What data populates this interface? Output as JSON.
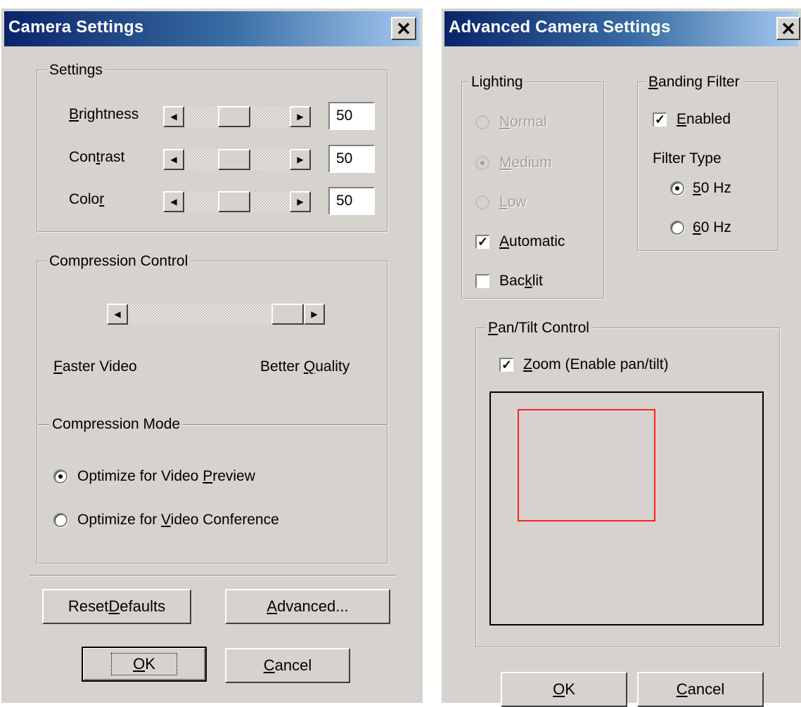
{
  "camera_settings": {
    "title": "Camera Settings",
    "close_glyph": "✕",
    "settings_group": "Settings",
    "brightness": {
      "label_u": "B",
      "label_rest": "rightness",
      "value": "50",
      "left_glyph": "◀",
      "right_glyph": "▶"
    },
    "contrast": {
      "label_pre": "Con",
      "label_u": "t",
      "label_rest": "rast",
      "value": "50",
      "left_glyph": "◀",
      "right_glyph": "▶"
    },
    "color": {
      "label_pre": "Colo",
      "label_u": "r",
      "value": "50",
      "left_glyph": "◀",
      "right_glyph": "▶"
    },
    "compression_control_group": "Compression Control",
    "compression_slider": {
      "left_glyph": "◀",
      "right_glyph": "▶"
    },
    "faster_video": {
      "u": "F",
      "rest": "aster Video"
    },
    "better_quality": {
      "pre": "Better ",
      "u": "Q",
      "rest": "uality"
    },
    "compression_mode_group": "Compression Mode",
    "mode_preview": {
      "pre": "Optimize for Video ",
      "u": "P",
      "rest": "review",
      "selected": true
    },
    "mode_conference": {
      "pre": "Optimize for ",
      "u": "V",
      "rest": "ideo Conference",
      "selected": false
    },
    "reset_defaults": {
      "pre": "Reset ",
      "u": "D",
      "rest": "efaults"
    },
    "advanced": {
      "u": "A",
      "rest": "dvanced..."
    },
    "ok": {
      "u": "O",
      "rest": "K"
    },
    "cancel": {
      "u": "C",
      "rest": "ancel"
    }
  },
  "advanced_settings": {
    "title": "Advanced Camera Settings",
    "close_glyph": "✕",
    "lighting_group": "Lighting",
    "normal": {
      "u": "N",
      "rest": "ormal",
      "enabled": false,
      "selected": false
    },
    "medium": {
      "u": "M",
      "rest": "edium",
      "enabled": false,
      "selected": true
    },
    "low": {
      "u": "L",
      "rest": "ow",
      "enabled": false,
      "selected": false
    },
    "automatic": {
      "u": "A",
      "rest": "utomatic",
      "checked": true,
      "check_glyph": "✓"
    },
    "backlit": {
      "pre": "Bac",
      "u": "k",
      "rest": "lit",
      "checked": false
    },
    "banding_group": {
      "u": "B",
      "rest": "anding Filter"
    },
    "banding_enabled": {
      "u": "E",
      "rest": "nabled",
      "checked": true,
      "check_glyph": "✓"
    },
    "filter_type": "Filter Type",
    "hz50": {
      "u": "5",
      "rest": "0 Hz",
      "selected": true
    },
    "hz60": {
      "u": "6",
      "rest": "0 Hz",
      "selected": false
    },
    "pan_tilt_group": {
      "u": "P",
      "rest": "an/Tilt Control"
    },
    "zoom": {
      "u": "Z",
      "rest": "oom (Enable pan/tilt)",
      "checked": true,
      "check_glyph": "✓"
    },
    "zoom_area_color": "#ff2020",
    "ok": {
      "u": "O",
      "rest": "K"
    },
    "cancel": {
      "u": "C",
      "rest": "ancel"
    }
  }
}
